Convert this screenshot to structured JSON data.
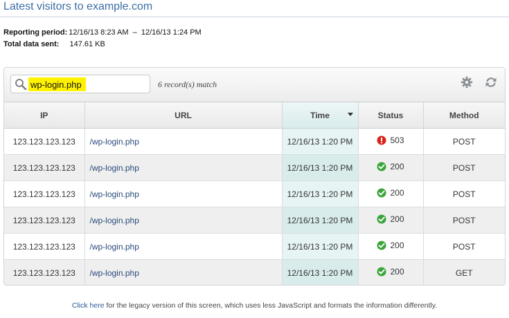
{
  "header": {
    "title": "Latest visitors to example.com"
  },
  "meta": {
    "period_label": "Reporting period:",
    "period_value": "12/16/13 8:23 AM  –  12/16/13 1:24 PM",
    "total_label": "Total data sent:",
    "total_value": "147.61 KB"
  },
  "toolbar": {
    "search_value": "wp-login.php",
    "match_text": "6 record(s) match",
    "icons": [
      "search-icon",
      "gear-icon",
      "refresh-icon"
    ]
  },
  "table": {
    "columns": [
      "IP",
      "URL",
      "Time",
      "Status",
      "Method"
    ],
    "sorted_column": "Time",
    "rows": [
      {
        "ip": "123.123.123.123",
        "url": "/wp-login.php",
        "time": "12/16/13 1:20 PM",
        "status": "503",
        "status_kind": "error",
        "method": "POST"
      },
      {
        "ip": "123.123.123.123",
        "url": "/wp-login.php",
        "time": "12/16/13 1:20 PM",
        "status": "200",
        "status_kind": "ok",
        "method": "POST"
      },
      {
        "ip": "123.123.123.123",
        "url": "/wp-login.php",
        "time": "12/16/13 1:20 PM",
        "status": "200",
        "status_kind": "ok",
        "method": "POST"
      },
      {
        "ip": "123.123.123.123",
        "url": "/wp-login.php",
        "time": "12/16/13 1:20 PM",
        "status": "200",
        "status_kind": "ok",
        "method": "POST"
      },
      {
        "ip": "123.123.123.123",
        "url": "/wp-login.php",
        "time": "12/16/13 1:20 PM",
        "status": "200",
        "status_kind": "ok",
        "method": "POST"
      },
      {
        "ip": "123.123.123.123",
        "url": "/wp-login.php",
        "time": "12/16/13 1:20 PM",
        "status": "200",
        "status_kind": "ok",
        "method": "GET"
      }
    ]
  },
  "footer": {
    "link_text": "Click here",
    "rest_text": " for the legacy version of this screen, which uses less JavaScript and formats the information differently."
  },
  "colors": {
    "title": "#3a6ea5",
    "search_highlight": "#fff200",
    "status_ok": "#3aa53a",
    "status_error": "#d9241b",
    "link": "#2b5797"
  }
}
